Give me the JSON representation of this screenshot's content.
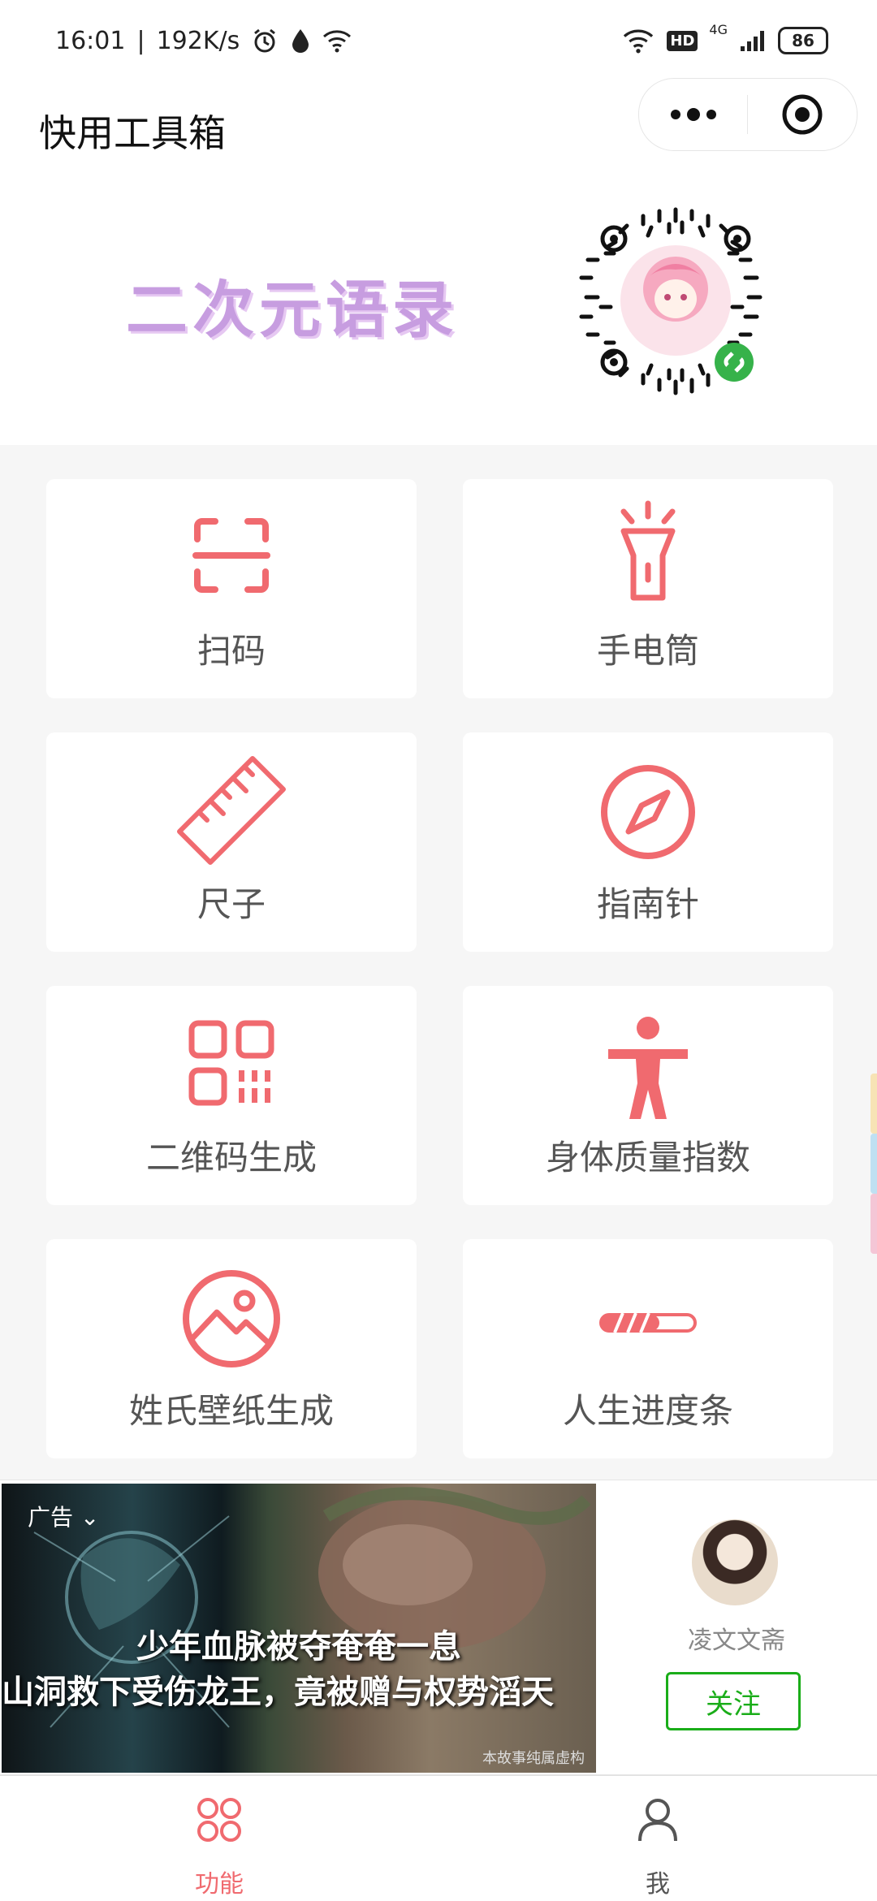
{
  "status_bar": {
    "time": "16:01",
    "speed": "192K/s",
    "network": "4G",
    "hd": "HD",
    "battery": "86"
  },
  "nav": {
    "title": "快用工具箱"
  },
  "banner": {
    "text": "二次元语录"
  },
  "tools": [
    {
      "label": "扫码",
      "icon": "scan-icon"
    },
    {
      "label": "手电筒",
      "icon": "flashlight-icon"
    },
    {
      "label": "尺子",
      "icon": "ruler-icon"
    },
    {
      "label": "指南针",
      "icon": "compass-icon"
    },
    {
      "label": "二维码生成",
      "icon": "qr-code-icon"
    },
    {
      "label": "身体质量指数",
      "icon": "body-icon"
    },
    {
      "label": "姓氏壁纸生成",
      "icon": "image-icon"
    },
    {
      "label": "人生进度条",
      "icon": "progress-bar-icon"
    }
  ],
  "ad": {
    "tag": "广告",
    "line1": "少年血脉被夺奄奄一息",
    "line2": "山洞救下受伤龙王，竟被赠与权势滔天",
    "footnote": "本故事纯属虚构",
    "author": "凌文文斋",
    "follow": "关注"
  },
  "tabbar": {
    "items": [
      {
        "label": "功能",
        "active": true
      },
      {
        "label": "我",
        "active": false
      }
    ]
  },
  "colors": {
    "accent": "#f06a6f",
    "follow_green": "#1aad19"
  }
}
